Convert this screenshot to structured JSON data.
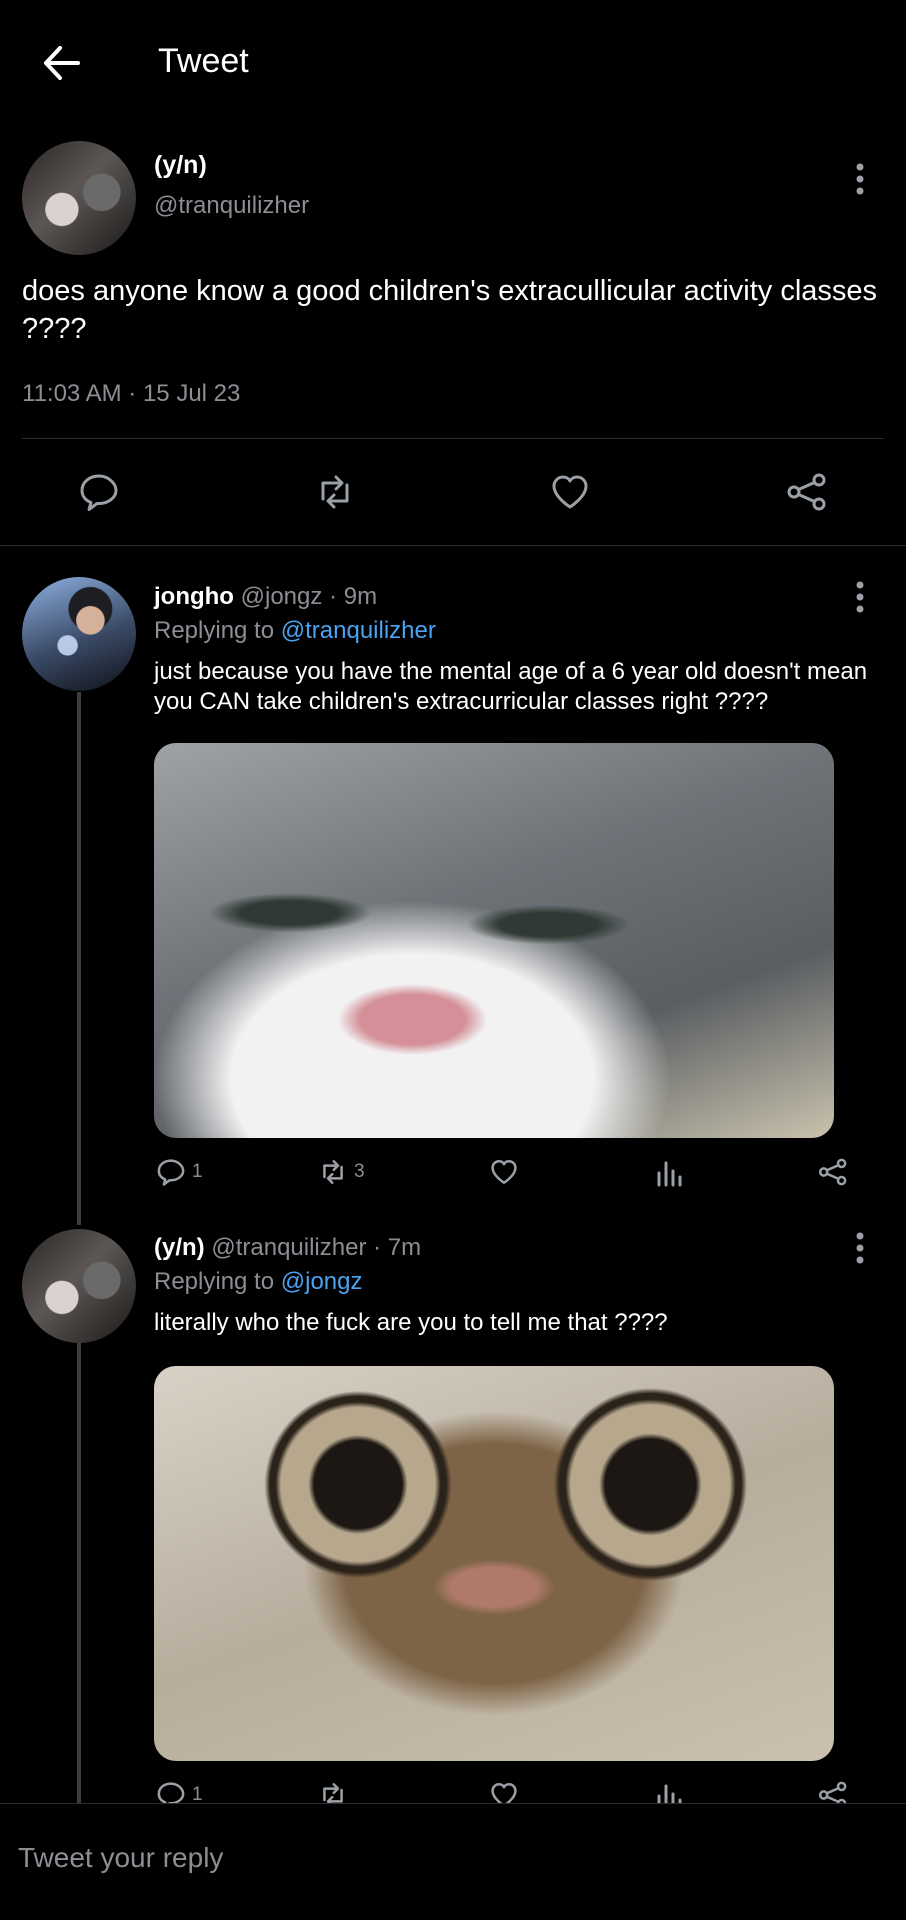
{
  "header": {
    "title": "Tweet"
  },
  "main_tweet": {
    "name": "(y/n)",
    "handle": "@tranquilizher",
    "text": "does anyone know a good children's extracullicular activity classes ????",
    "timestamp": "11:03 AM · 15 Jul 23"
  },
  "replies": [
    {
      "name": "jongho",
      "handle": "@jongz",
      "time": "· 9m",
      "replying_label": "Replying to",
      "replying_to": "@tranquilizher",
      "text": "just because you have the mental age of a 6 year old doesn't mean you CAN take children's extracurricular classes right ????",
      "reply_count": "1",
      "retweet_count": "3"
    },
    {
      "name": "(y/n)",
      "handle": "@tranquilizher",
      "time": "· 7m",
      "replying_label": "Replying to",
      "replying_to": "@jongz",
      "text": "literally who the fuck are you to tell me that ????",
      "reply_count": "1",
      "retweet_count": ""
    }
  ],
  "reply_box": {
    "placeholder": "Tweet your reply"
  },
  "colors": {
    "background": "#000000",
    "accent_link": "#4aa3f0",
    "muted_text": "#8b8f94"
  },
  "icons": [
    "back-arrow-icon",
    "more-icon",
    "reply-icon",
    "retweet-icon",
    "like-icon",
    "share-icon",
    "analytics-icon"
  ]
}
